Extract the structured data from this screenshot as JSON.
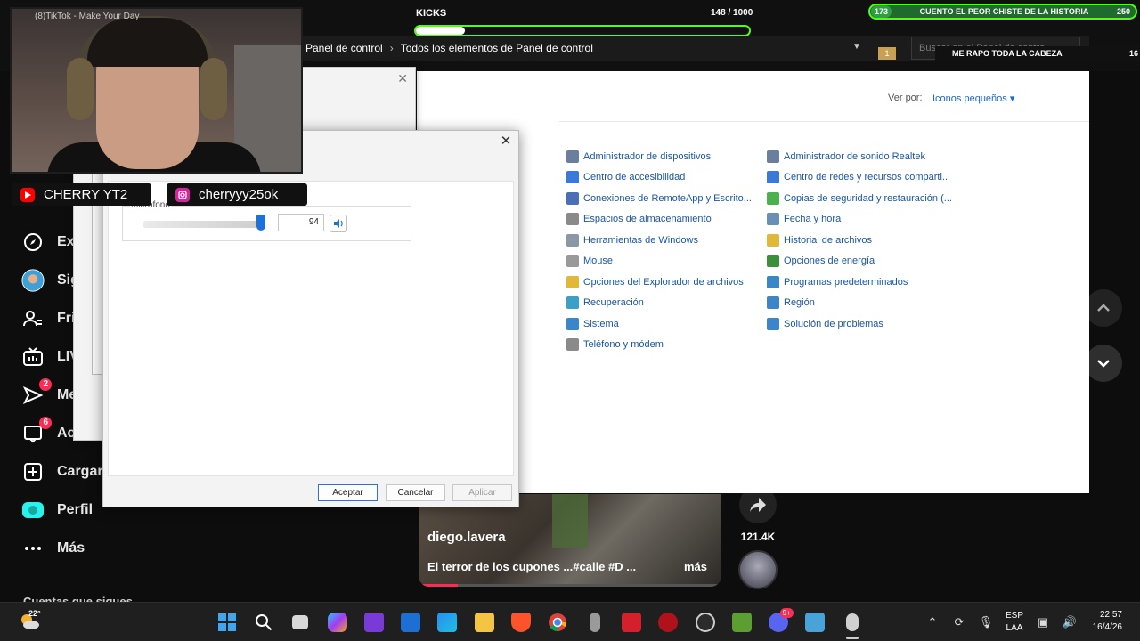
{
  "tiktok": {
    "nav": [
      {
        "label": "Ex",
        "icon": "compass-icon"
      },
      {
        "label": "Sig",
        "icon": "avatar"
      },
      {
        "label": "Fri",
        "icon": "friends-icon"
      },
      {
        "label": "LIV",
        "icon": "live-tv-icon"
      },
      {
        "label": "Me",
        "icon": "messages-icon",
        "badge": "2"
      },
      {
        "label": "Ac",
        "icon": "activity-icon",
        "badge": "6"
      },
      {
        "label": "Cargar",
        "icon": "upload-icon"
      },
      {
        "label": "Perfil",
        "icon": "profile-icon"
      },
      {
        "label": "Más",
        "icon": "more-icon"
      }
    ],
    "following_title": "Cuentas que sigues",
    "video": {
      "author": "diego.lavera",
      "description": "El terror de los cupones ...#calle #D ...",
      "more": "más",
      "progress_fraction": 0.13
    },
    "share_count": "121.4K"
  },
  "overlay": {
    "kicks_label": "KICKS",
    "kicks_count": "148 / 1000",
    "kicks_progress_fraction": 0.148,
    "goal": {
      "current": "173",
      "text": "CUENTO EL PEOR CHISTE DE LA HISTORIA",
      "max": "250"
    },
    "rapo": {
      "badge": "1",
      "text": "ME RAPO TODA LA CABEZA",
      "count": "16"
    },
    "social": [
      {
        "label": "CHERRY YT2",
        "icon": "youtube-icon",
        "color": "#ff0000"
      },
      {
        "label": "cherryyy25ok",
        "icon": "instagram-icon",
        "color": "#d6249f"
      }
    ],
    "cam_title": "(8)TikTok - Make Your Day"
  },
  "explorer": {
    "breadcrumb": [
      "Panel de control",
      "Todos los elementos de Panel de control"
    ],
    "search_placeholder": "Buscar en el Panel de control",
    "view_by_label": "Ver por:",
    "view_by_value": "Iconos pequeños"
  },
  "control_panel": {
    "left": [
      {
        "label": "Administrador de dispositivos",
        "color": "#6a7f9e"
      },
      {
        "label": "Centro de accesibilidad",
        "color": "#3b78d8"
      },
      {
        "label": "Conexiones de RemoteApp y Escrito...",
        "color": "#4a6fb5"
      },
      {
        "label": "Espacios de almacenamiento",
        "color": "#8a8a8a"
      },
      {
        "label": "Herramientas de Windows",
        "color": "#8a97a6"
      },
      {
        "label": "Mouse",
        "color": "#9a9a9a"
      },
      {
        "label": "Opciones del Explorador de archivos",
        "color": "#e0b83a"
      },
      {
        "label": "Recuperación",
        "color": "#3aa0c8"
      },
      {
        "label": "Sistema",
        "color": "#3a86c8"
      },
      {
        "label": "Teléfono y módem",
        "color": "#8a8a8a"
      }
    ],
    "right": [
      {
        "label": "Administrador de sonido Realtek",
        "color": "#6a7f9e"
      },
      {
        "label": "Centro de redes y recursos comparti...",
        "color": "#3b78d8"
      },
      {
        "label": "Copias de seguridad y restauración (...",
        "color": "#4caf50"
      },
      {
        "label": "Fecha y hora",
        "color": "#6a8fb5"
      },
      {
        "label": "Historial de archivos",
        "color": "#e0b83a"
      },
      {
        "label": "Opciones de energía",
        "color": "#3d8f3d"
      },
      {
        "label": "Programas predeterminados",
        "color": "#3a86c8"
      },
      {
        "label": "Región",
        "color": "#3a86c8"
      },
      {
        "label": "Solución de problemas",
        "color": "#3a86c8"
      }
    ]
  },
  "mic_dialog": {
    "tab_fragment": "adas",
    "group_label": "Micrófono",
    "volume": "94",
    "level_fraction": 0.94,
    "buttons": {
      "ok": "Aceptar",
      "cancel": "Cancelar",
      "apply": "Aplicar"
    }
  },
  "taskbar": {
    "temperature": "22°",
    "language": "ESP",
    "layout": "LAA",
    "time": "22:57",
    "date": "16/4/26",
    "discord_badge": "9+"
  }
}
